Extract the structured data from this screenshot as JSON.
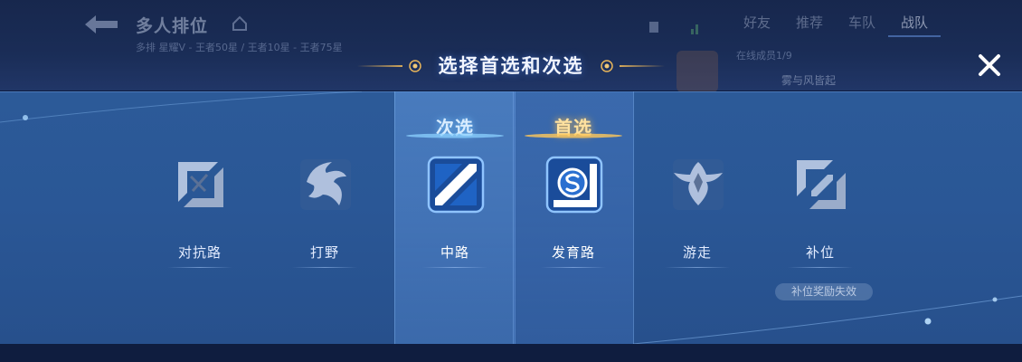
{
  "background": {
    "mode_title": "多人排位",
    "mode_subtitle": "多排 星耀V - 王者50星 / 王者10星 - 王者75星",
    "tabs": [
      {
        "label": "好友",
        "active": false
      },
      {
        "label": "推荐",
        "active": false
      },
      {
        "label": "车队",
        "active": false
      },
      {
        "label": "战队",
        "active": true
      }
    ],
    "online_members": "在线成员1/9",
    "member_name": "雾与风皆起"
  },
  "dialog": {
    "title": "选择首选和次选",
    "close_icon": "close-x-icon"
  },
  "tags": {
    "secondary": "次选",
    "primary": "首选"
  },
  "lanes": [
    {
      "label": "对抗路",
      "icon": "clash-lane-icon",
      "state": "none"
    },
    {
      "label": "打野",
      "icon": "jungle-icon",
      "state": "none"
    },
    {
      "label": "中路",
      "icon": "mid-lane-icon",
      "state": "secondary"
    },
    {
      "label": "发育路",
      "icon": "farm-lane-icon",
      "state": "primary"
    },
    {
      "label": "游走",
      "icon": "roam-icon",
      "state": "none"
    },
    {
      "label": "补位",
      "icon": "fill-icon",
      "state": "none",
      "badge": "补位奖励失效"
    }
  ],
  "colors": {
    "panel": "#2a5796",
    "secondary_tag": "#d8ecff",
    "primary_tag": "#ffe2a0",
    "accent_gold": "#e8b55a"
  }
}
